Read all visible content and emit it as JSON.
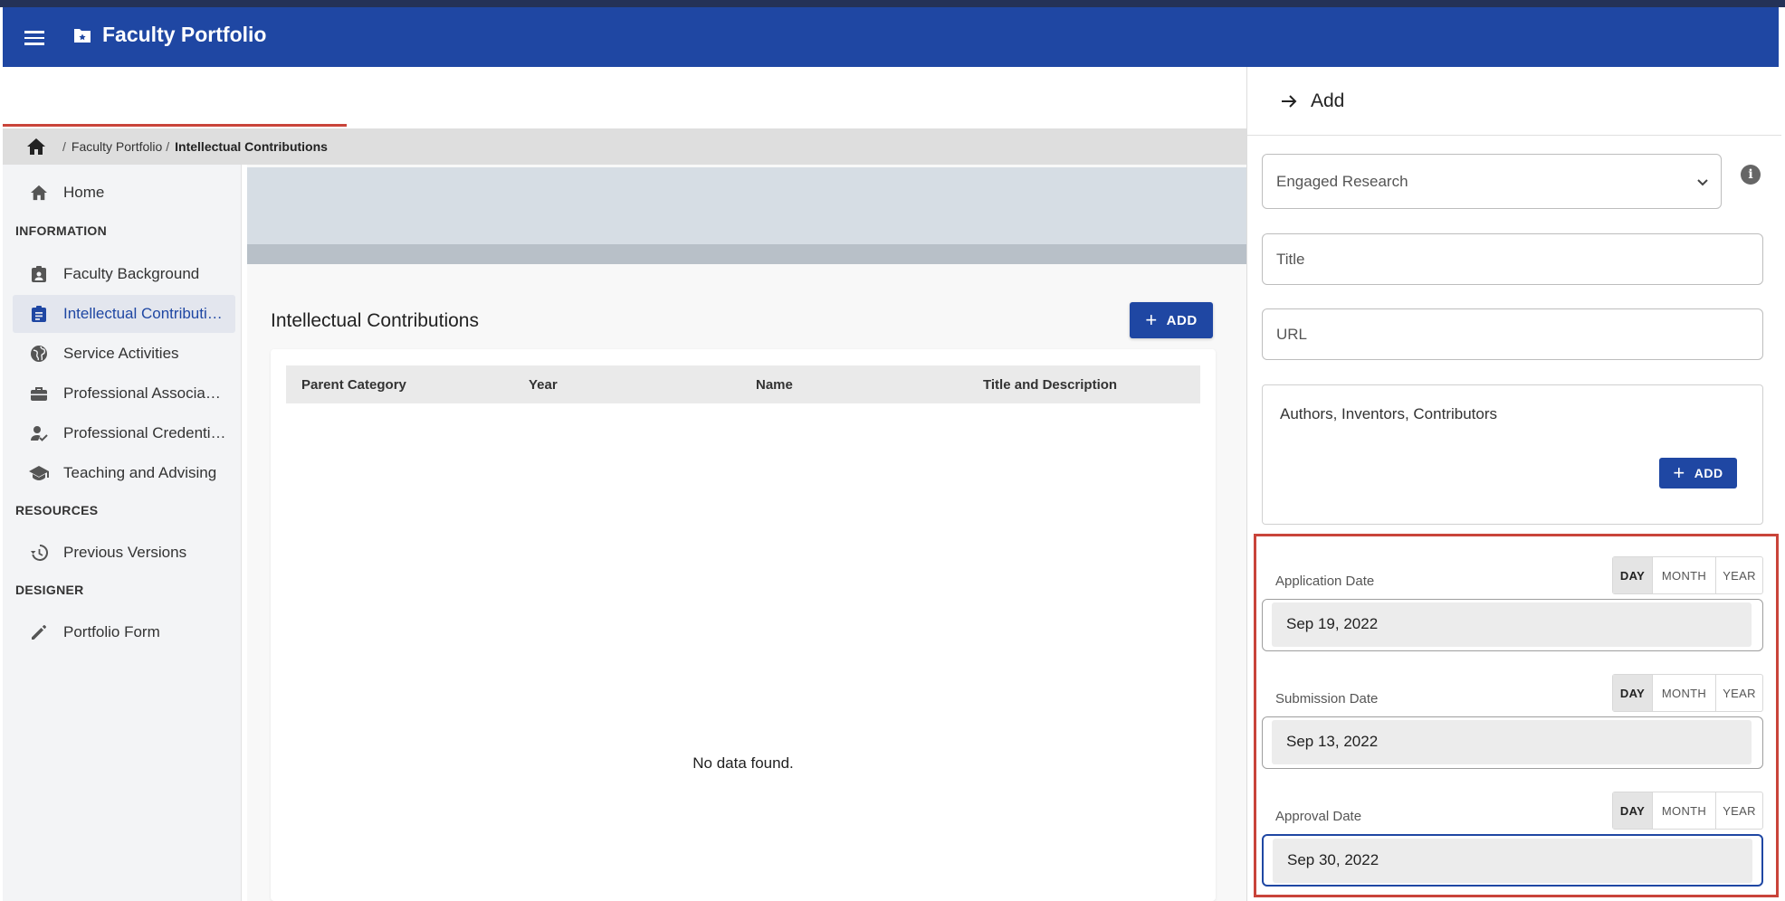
{
  "app": {
    "title": "Faculty Portfolio"
  },
  "breadcrumb": {
    "items": [
      "Faculty Portfolio",
      "Intellectual Contributions"
    ]
  },
  "sidebar": {
    "home": "Home",
    "sections": {
      "information": "INFORMATION",
      "resources": "RESOURCES",
      "designer": "DESIGNER"
    },
    "items": [
      {
        "label": "Faculty Background",
        "icon": "badge-icon"
      },
      {
        "label": "Intellectual Contributi…",
        "icon": "clipboard-icon",
        "active": true
      },
      {
        "label": "Service Activities",
        "icon": "globe-icon"
      },
      {
        "label": "Professional Associa…",
        "icon": "briefcase-icon"
      },
      {
        "label": "Professional Credenti…",
        "icon": "person-check-icon"
      },
      {
        "label": "Teaching and Advising",
        "icon": "graduation-cap-icon"
      }
    ],
    "resources_items": [
      {
        "label": "Previous Versions",
        "icon": "history-icon"
      }
    ],
    "designer_items": [
      {
        "label": "Portfolio Form",
        "icon": "pencil-icon"
      }
    ]
  },
  "main": {
    "title": "Intellectual Contributions",
    "add_label": "ADD",
    "columns": [
      "Parent Category",
      "Year",
      "Name",
      "Title and Description"
    ],
    "empty_message": "No data found."
  },
  "panel": {
    "title": "Add",
    "category_value": "Engaged Research",
    "title_placeholder": "Title",
    "url_placeholder": "URL",
    "authors_label": "Authors, Inventors, Contributors",
    "authors_add_label": "ADD",
    "toggle_options": [
      "DAY",
      "MONTH",
      "YEAR"
    ],
    "dates": [
      {
        "label": "Application Date",
        "value": "Sep 19, 2022",
        "mode": "DAY"
      },
      {
        "label": "Submission Date",
        "value": "Sep 13, 2022",
        "mode": "DAY"
      },
      {
        "label": "Approval Date",
        "value": "Sep 30, 2022",
        "mode": "DAY"
      }
    ]
  },
  "colors": {
    "primary": "#1f47a3",
    "highlight": "#c9443a",
    "sidebar_bg": "#f3f4f6",
    "banner": "#d6dde4"
  }
}
